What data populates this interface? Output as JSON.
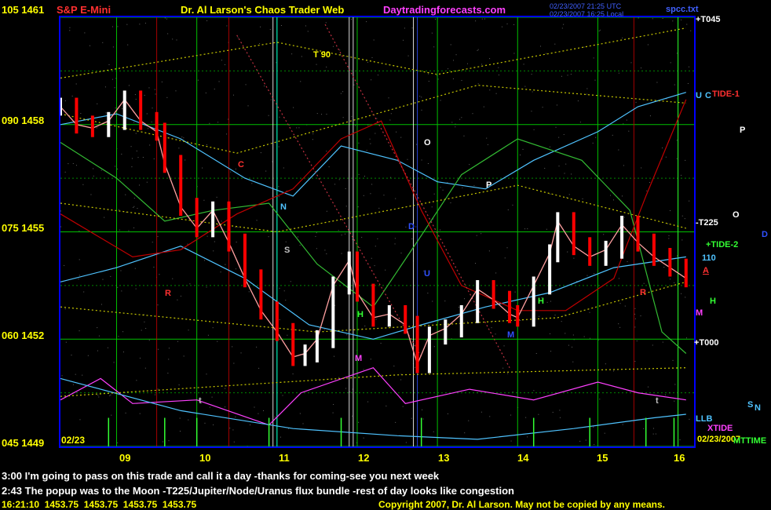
{
  "header": {
    "symbol": "S&P E-Mini",
    "title": "Dr. Al Larson's Chaos Trader Web",
    "website": "Daytradingforecasts.com",
    "timestamp_utc": "02/23/2007 21:25 UTC",
    "timestamp_local": "02/23/2007 16:25 Local",
    "file": "spcc.txt",
    "top_left_price": "105 1461"
  },
  "y_axis_labels": [
    "090 1458",
    "075 1455",
    "060 1452",
    "045 1449"
  ],
  "x_axis": {
    "date": "02/23",
    "ticks": [
      "09",
      "10",
      "11",
      "12",
      "13",
      "14",
      "15",
      "16"
    ],
    "end_date": "02/23/2007"
  },
  "right_labels": [
    {
      "text": "+T045",
      "color": "#ffffff"
    },
    {
      "text": "U",
      "color": "#4fc3ff"
    },
    {
      "text": "C",
      "color": "#4fc3ff"
    },
    {
      "text": "TIDE-1",
      "color": "#ff3030"
    },
    {
      "text": "P",
      "color": "#ffffff"
    },
    {
      "text": "-T225",
      "color": "#ffffff"
    },
    {
      "text": "O",
      "color": "#ffffff"
    },
    {
      "text": "D",
      "color": "#3050ff"
    },
    {
      "text": "+TIDE-2",
      "color": "#33ff33"
    },
    {
      "text": "110",
      "color": "#4fc3ff"
    },
    {
      "text": "A",
      "color": "#ff3030"
    },
    {
      "text": "H",
      "color": "#33ff33"
    },
    {
      "text": "M",
      "color": "#ff40ff"
    },
    {
      "text": "+T000",
      "color": "#ffffff"
    },
    {
      "text": "S",
      "color": "#4fc3ff"
    },
    {
      "text": "N",
      "color": "#4fc3ff"
    },
    {
      "text": "LLB",
      "color": "#4fc3ff"
    },
    {
      "text": "XTIDE",
      "color": "#ff40ff"
    },
    {
      "text": "MTTIME",
      "color": "#33ff33"
    }
  ],
  "in_chart_labels": [
    {
      "text": "T 90",
      "color": "#ffff00"
    },
    {
      "text": "O",
      "color": "#ffffff"
    },
    {
      "text": "C",
      "color": "#ff3030"
    },
    {
      "text": "P",
      "color": "#ffffff"
    },
    {
      "text": "N",
      "color": "#4fc3ff"
    },
    {
      "text": "S",
      "color": "#c0c0c0"
    },
    {
      "text": "R",
      "color": "#ff3030"
    },
    {
      "text": "D",
      "color": "#3050ff"
    },
    {
      "text": "U",
      "color": "#3050ff"
    },
    {
      "text": "H",
      "color": "#33ff33"
    },
    {
      "text": "M",
      "color": "#ff40ff"
    },
    {
      "text": "H",
      "color": "#33ff33"
    },
    {
      "text": "M",
      "color": "#3050ff"
    },
    {
      "text": "R",
      "color": "#ff3030"
    },
    {
      "text": "t",
      "color": "#c0c0c0"
    },
    {
      "text": "t",
      "color": "#c0c0c0"
    }
  ],
  "comments": [
    "3:00 I'm going to pass on this trade and call it a day -thanks for coming-see you next week",
    "2:43 The popup was to the Moon -T225/Jupiter/Node/Uranus flux bundle -rest of day looks like congestion"
  ],
  "quote_line": "16:21:10  1453.75  1453.75  1453.75  1453.75",
  "copyright": "Copyright 2007, Dr. Al Larson. May not be copied by any means.",
  "colors": {
    "background": "#000000",
    "price_bars_down": "#ff0000",
    "price_bars_up": "#ffffff",
    "grid_green": "#00c000",
    "axis_border": "#0000ff",
    "header_red": "#ff3030",
    "header_yellow": "#ffff00",
    "header_magenta": "#ff40ff"
  },
  "chart_data": {
    "type": "line",
    "title": "S&P E-Mini",
    "ylim": [
      1449,
      1461
    ],
    "xlim": [
      8.3,
      16.2
    ],
    "y_ticks": [
      1449,
      1452,
      1455,
      1458,
      1461
    ],
    "x_ticks": [
      9,
      10,
      11,
      12,
      13,
      14,
      15,
      16
    ],
    "grid": true,
    "series": [
      {
        "name": "price",
        "x": [
          8.3,
          8.5,
          8.7,
          8.9,
          9.1,
          9.3,
          9.5,
          9.6,
          9.8,
          10.0,
          10.2,
          10.4,
          10.6,
          10.8,
          11.0,
          11.2,
          11.35,
          11.5,
          11.7,
          11.9,
          12.0,
          12.2,
          12.4,
          12.6,
          12.75,
          12.9,
          13.1,
          13.3,
          13.5,
          13.7,
          13.9,
          14.0,
          14.2,
          14.4,
          14.5,
          14.7,
          14.9,
          15.1,
          15.3,
          15.5,
          15.7,
          15.9,
          16.1
        ],
        "y": [
          1458.5,
          1458.0,
          1457.9,
          1458.1,
          1458.7,
          1458.1,
          1457.8,
          1456.9,
          1455.7,
          1455.1,
          1455.6,
          1454.7,
          1453.7,
          1452.8,
          1452.2,
          1451.5,
          1451.6,
          1452.0,
          1453.5,
          1454.2,
          1453.3,
          1452.6,
          1452.7,
          1452.4,
          1451.3,
          1452.1,
          1452.3,
          1452.7,
          1453.4,
          1453.1,
          1452.7,
          1452.6,
          1453.5,
          1454.4,
          1455.3,
          1454.6,
          1454.3,
          1454.5,
          1455.2,
          1454.7,
          1454.3,
          1454.0,
          1453.7
        ]
      }
    ]
  }
}
